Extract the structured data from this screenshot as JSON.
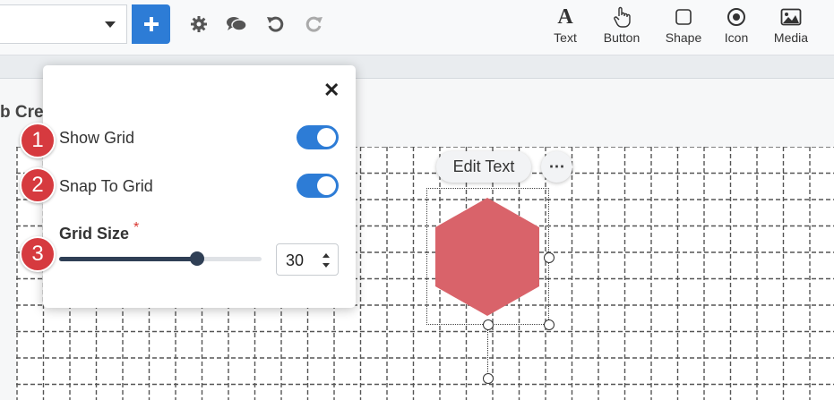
{
  "toolbar": {
    "dropdown": {
      "value": ""
    },
    "add_icon": "plus-icon",
    "icons": [
      "gear-icon",
      "chat-icon",
      "undo-icon",
      "redo-icon"
    ],
    "insert_items": [
      {
        "icon": "text-icon",
        "label": "Text"
      },
      {
        "icon": "button-icon",
        "label": "Button"
      },
      {
        "icon": "shape-icon",
        "label": "Shape"
      },
      {
        "icon": "icon-icon",
        "label": "Icon"
      },
      {
        "icon": "media-icon",
        "label": "Media"
      }
    ]
  },
  "page": {
    "title_fragment": "b Cre"
  },
  "canvas": {
    "edit_text_label": "Edit Text",
    "more_label": "⋯",
    "shape": {
      "type": "hexagon",
      "color": "#d9636a"
    }
  },
  "grid_settings": {
    "close_label": "✕",
    "show_grid": {
      "label": "Show Grid",
      "enabled": true
    },
    "snap_to_grid": {
      "label": "Snap To Grid",
      "enabled": true
    },
    "grid_size": {
      "label": "Grid Size",
      "required_mark": "*",
      "value": "30",
      "slider_fraction": 0.68
    }
  },
  "callouts": [
    "1",
    "2",
    "3"
  ],
  "colors": {
    "accent": "#2d7cd6",
    "badge": "#d63a3f",
    "slider": "#2f3f55",
    "shape": "#d9636a"
  }
}
